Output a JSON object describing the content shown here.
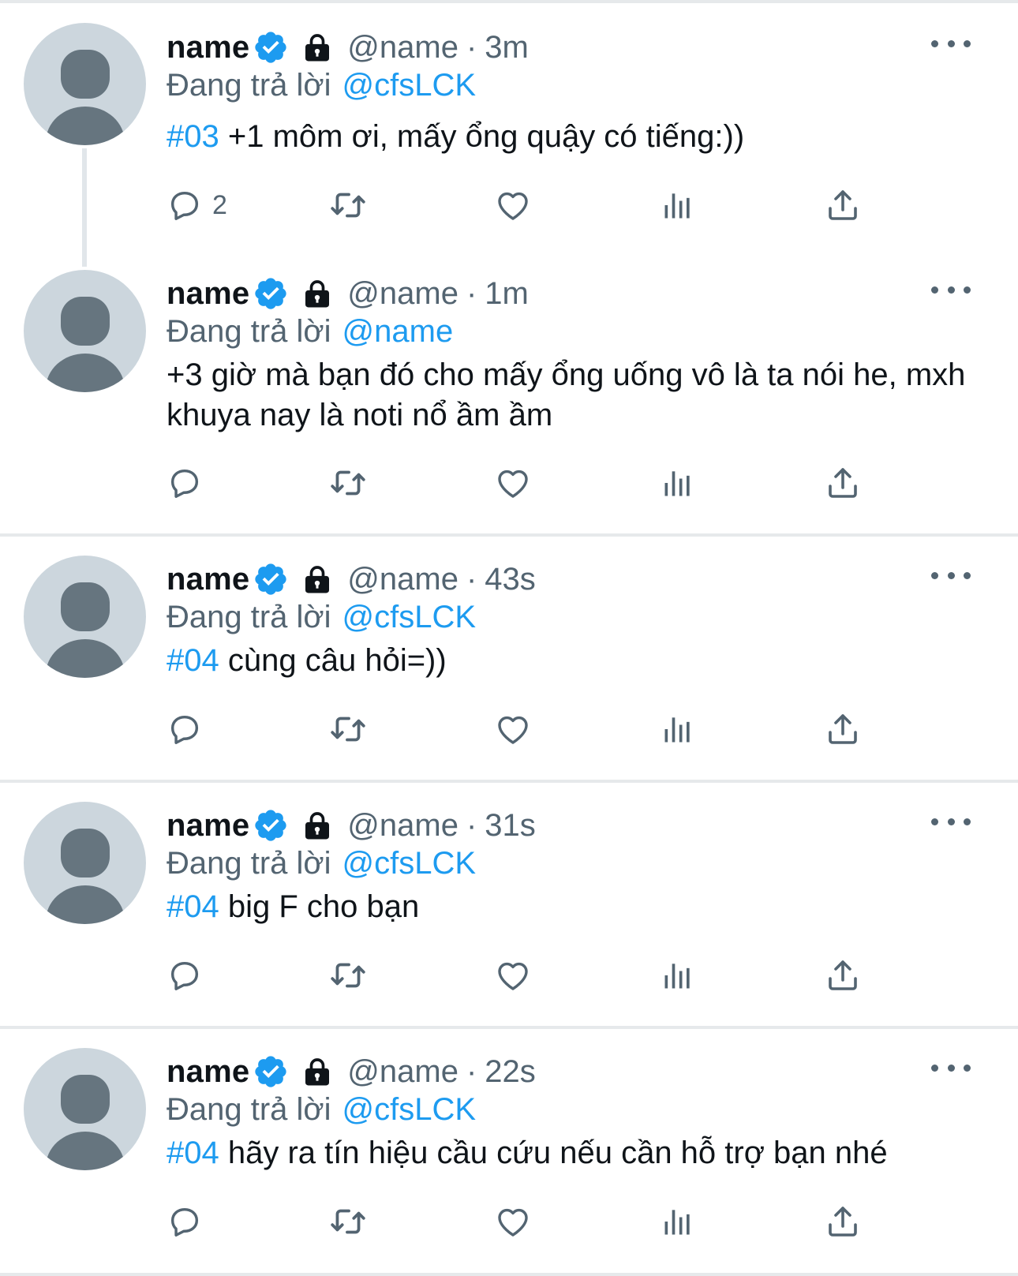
{
  "colors": {
    "accent": "#1d9bf0",
    "secondary_text": "#536471",
    "primary_text": "#0f1419",
    "separator": "#e6e9eb",
    "avatar_bg": "#ccd6dd",
    "avatar_fg": "#66757f"
  },
  "icons": {
    "verified": "verified-badge-icon",
    "lock": "lock-icon",
    "reply": "reply-icon",
    "retweet": "retweet-icon",
    "like": "like-icon",
    "views": "views-icon",
    "share": "share-icon",
    "more": "more-icon"
  },
  "tweets": [
    {
      "display_name": "name",
      "handle": "@name",
      "separator": "·",
      "time": "3m",
      "reply_prefix": "Đang trả lời",
      "reply_to": "@cfsLCK",
      "hashtag": "#03",
      "text": " +1 môm ơi, mấy ổng quậy có tiếng:))",
      "reply_count": "2"
    },
    {
      "display_name": "name",
      "handle": "@name",
      "separator": "·",
      "time": "1m",
      "reply_prefix": "Đang trả lời",
      "reply_to": "@name",
      "hashtag": "",
      "text": "+3 giờ mà bạn đó cho mấy ổng uống vô là ta nói he, mxh khuya nay là noti nổ ầm ầm",
      "reply_count": ""
    },
    {
      "display_name": "name",
      "handle": "@name",
      "separator": "·",
      "time": "43s",
      "reply_prefix": "Đang trả lời",
      "reply_to": "@cfsLCK",
      "hashtag": "#04",
      "text": " cùng câu hỏi=))",
      "reply_count": ""
    },
    {
      "display_name": "name",
      "handle": "@name",
      "separator": "·",
      "time": "31s",
      "reply_prefix": "Đang trả lời",
      "reply_to": "@cfsLCK",
      "hashtag": "#04",
      "text": " big F cho bạn",
      "reply_count": ""
    },
    {
      "display_name": "name",
      "handle": "@name",
      "separator": "·",
      "time": "22s",
      "reply_prefix": "Đang trả lời",
      "reply_to": "@cfsLCK",
      "hashtag": "#04",
      "text": " hãy ra tín hiệu cầu cứu nếu cần hỗ trợ bạn nhé",
      "reply_count": ""
    }
  ]
}
